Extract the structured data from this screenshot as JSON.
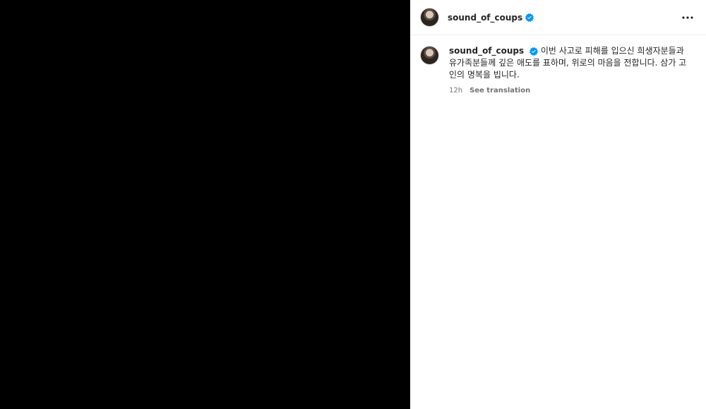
{
  "post": {
    "author": {
      "username": "sound_of_coups",
      "verified": true,
      "verified_color": "#0095f6",
      "avatar_icon": "profile-photo"
    },
    "header": {
      "more_icon": "more-options-icon"
    },
    "caption": {
      "username": "sound_of_coups",
      "text": "이번 사고로 피해를 입으신 희생자분들과 유가족분들께 깊은 애도를 표하며, 위로의 마음을 전합니다. 삼가 고인의 명복을 빕니다.",
      "time_ago": "12h",
      "translation_label": "See translation"
    }
  },
  "colors": {
    "media_background": "#000000",
    "panel_background": "#ffffff",
    "text_primary": "#262626",
    "text_secondary": "#737373"
  }
}
